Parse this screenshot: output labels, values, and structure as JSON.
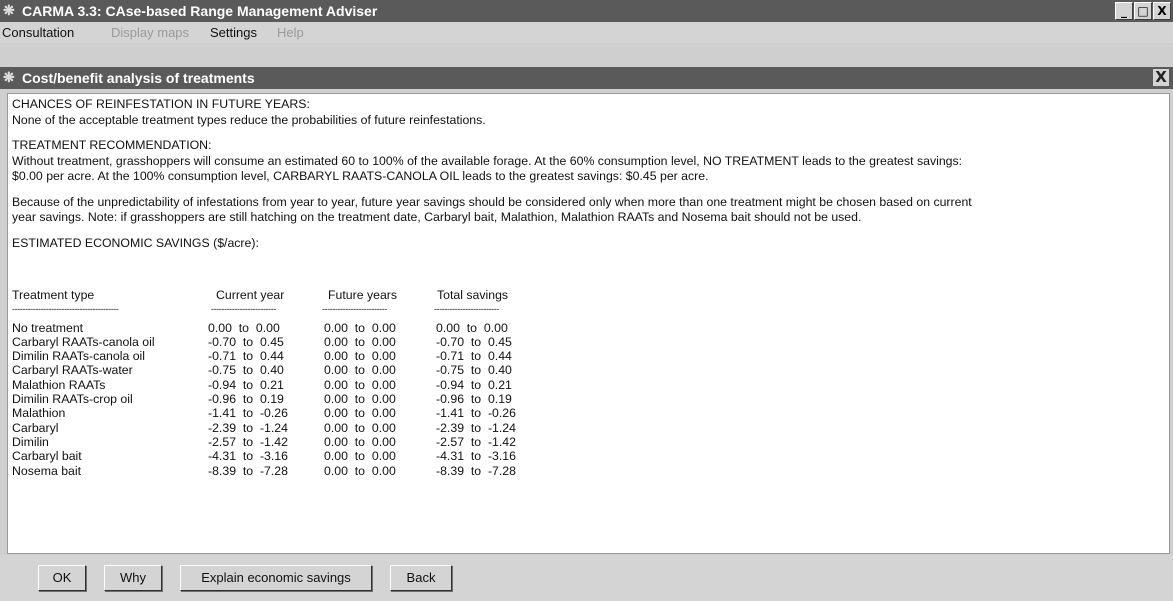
{
  "app": {
    "title": "CARMA 3.3: CAse-based Range Management Adviser",
    "window_icon": "grasshopper-icon",
    "window_buttons": [
      "_",
      "□",
      "X"
    ]
  },
  "menu": [
    {
      "label": "Consultation",
      "enabled": true
    },
    {
      "label": "Display maps",
      "enabled": false
    },
    {
      "label": "Settings",
      "enabled": true
    },
    {
      "label": "Help",
      "enabled": false
    }
  ],
  "dialog": {
    "title": "Cost/benefit analysis of treatments",
    "close_label": "X"
  },
  "report": {
    "reinfestation_heading": "CHANCES OF REINFESTATION IN FUTURE YEARS:",
    "reinfestation_text": "None of the acceptable treatment types reduce the probabilities of future reinfestations.",
    "recommendation_heading": "TREATMENT RECOMMENDATION:",
    "recommendation_line1": "Without treatment, grasshoppers will consume an estimated 60 to 100% of the available forage.  At the 60% consumption level, NO TREATMENT leads to the greatest savings:",
    "recommendation_line2": "$0.00 per acre.  At the 100% consumption level, CARBARYL RAATS-CANOLA OIL leads to the greatest savings: $0.45 per acre.",
    "caution_line1": "Because of the unpredictability of infestations from year to year,  future year savings should be considered only when more than one treatment might be chosen based on current",
    "caution_line2": "year savings.  Note: if grasshoppers are still hatching on the treatment date, Carbaryl bait, Malathion, Malathion RAATs and Nosema bait should not be used.",
    "savings_heading": "ESTIMATED ECONOMIC SAVINGS ($/acre):"
  },
  "savings_table": {
    "headers": [
      "Treatment type",
      "Current year",
      "Future years",
      "Total savings"
    ],
    "rows": [
      [
        "No treatment",
        "0.00  to  0.00",
        "0.00  to  0.00",
        "0.00  to  0.00"
      ],
      [
        "Carbaryl RAATs-canola oil",
        "-0.70  to  0.45",
        "0.00  to  0.00",
        "-0.70  to  0.45"
      ],
      [
        "Dimilin RAATs-canola oil",
        "-0.71  to  0.44",
        "0.00  to  0.00",
        "-0.71  to  0.44"
      ],
      [
        "Carbaryl RAATs-water",
        "-0.75  to  0.40",
        "0.00  to  0.00",
        "-0.75  to  0.40"
      ],
      [
        "Malathion RAATs",
        "-0.94  to  0.21",
        "0.00  to  0.00",
        "-0.94  to  0.21"
      ],
      [
        "Dimilin RAATs-crop oil",
        "-0.96  to  0.19",
        "0.00  to  0.00",
        "-0.96  to  0.19"
      ],
      [
        "Malathion",
        "-1.41  to  -0.26",
        "0.00  to  0.00",
        "-1.41  to  -0.26"
      ],
      [
        "Carbaryl",
        "-2.39  to  -1.24",
        "0.00  to  0.00",
        "-2.39  to  -1.24"
      ],
      [
        "Dimilin",
        "-2.57  to  -1.42",
        "0.00  to  0.00",
        "-2.57  to  -1.42"
      ],
      [
        "Carbaryl bait",
        "-4.31  to  -3.16",
        "0.00  to  0.00",
        "-4.31  to  -3.16"
      ],
      [
        "Nosema bait",
        "-8.39  to  -7.28",
        "0.00  to  0.00",
        "-8.39  to  -7.28"
      ]
    ]
  },
  "buttons": {
    "ok": "OK",
    "why": "Why",
    "explain": "Explain economic savings",
    "back": "Back"
  }
}
